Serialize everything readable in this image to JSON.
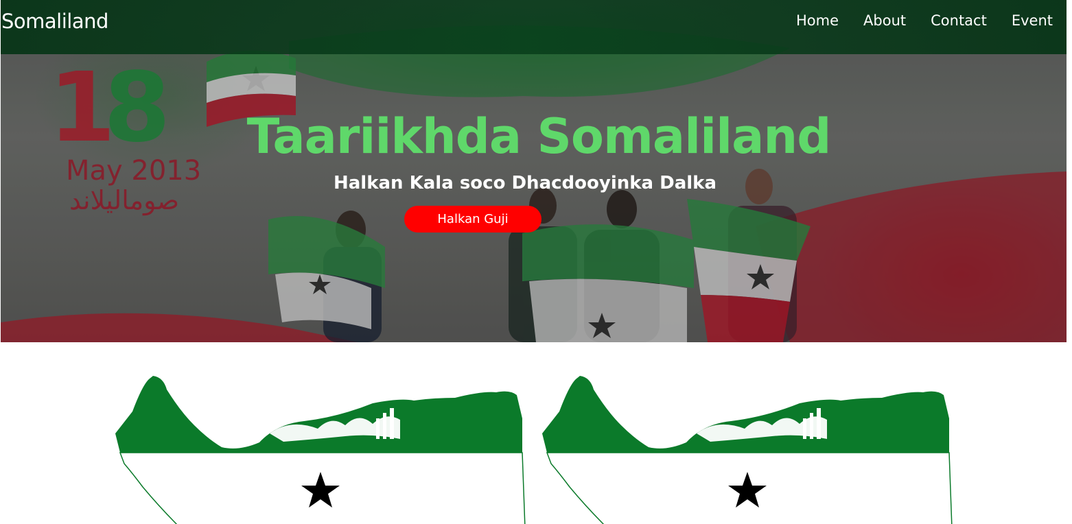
{
  "nav": {
    "brand": "Somaliland",
    "links": [
      {
        "label": "Home"
      },
      {
        "label": "About"
      },
      {
        "label": "Contact"
      },
      {
        "label": "Event"
      }
    ]
  },
  "hero": {
    "title": "Taariikhda Somaliland",
    "subtitle": "Halkan Kala soco Dhacdooyinka Dalka",
    "button_label": "Halkan Guji",
    "background_text": {
      "number": "18",
      "date": "May 2013",
      "arabic": "صوماليلاند"
    }
  },
  "maps": [
    {
      "name": "somaliland-flag-map"
    },
    {
      "name": "somaliland-flag-map"
    }
  ],
  "colors": {
    "nav_bg": "#063416",
    "title_green": "#5fd86a",
    "button_red": "#ff0000",
    "flag_green": "#0b7a2a",
    "flag_red": "#c8102e"
  }
}
